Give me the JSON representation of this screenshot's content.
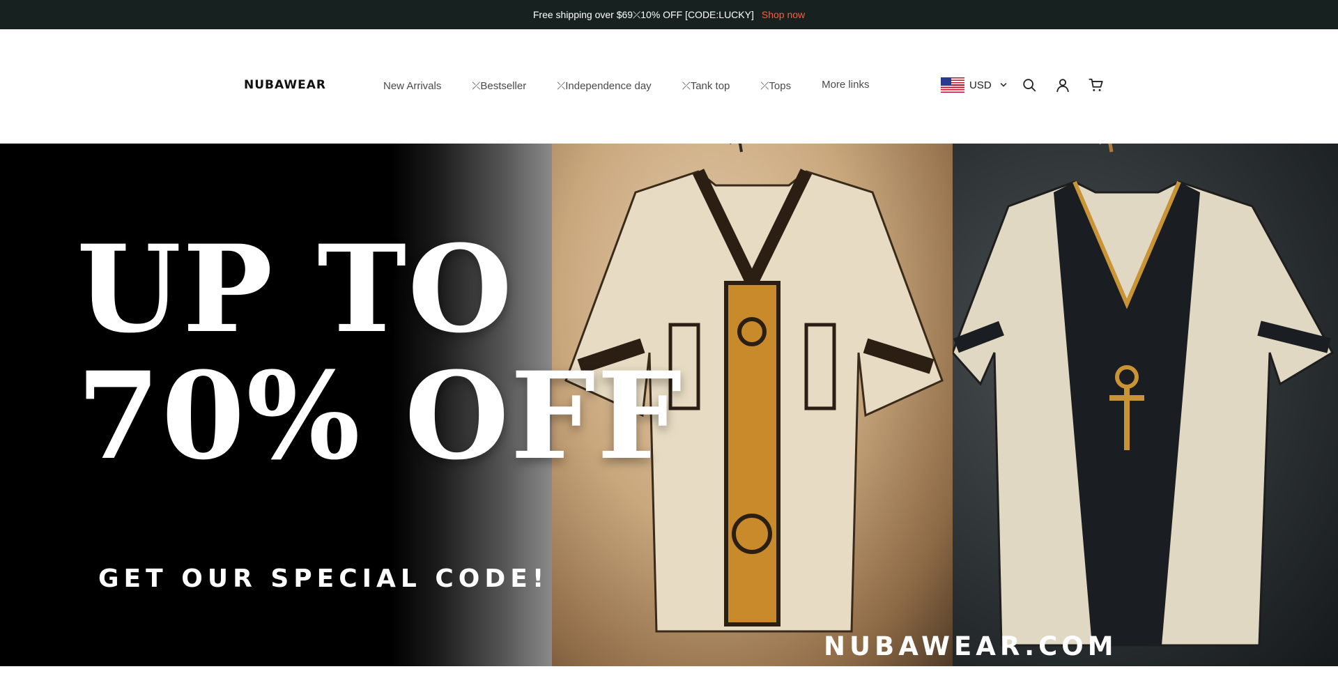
{
  "announcement": {
    "text": "Free shipping over $69⤫10% OFF [CODE:LUCKY]",
    "link_label": "Shop now",
    "link_color": "#ff5a3c",
    "background": "#172220"
  },
  "header": {
    "logo": "NUBAWEAR",
    "nav": [
      {
        "label": "New Arrivals"
      },
      {
        "label": "⤫Bestseller"
      },
      {
        "label": "⤫Independence day"
      },
      {
        "label": "⤫Tank top"
      },
      {
        "label": "⤫Tops"
      },
      {
        "label": "More links"
      }
    ],
    "currency": {
      "code": "USD",
      "flag": "us-flag-icon"
    },
    "icons": [
      "search-icon",
      "account-icon",
      "cart-icon"
    ]
  },
  "hero": {
    "headline_line1": "UP TO",
    "headline_line2": "70% OFF",
    "subheadline": "GET OUR SPECIAL CODE!",
    "watermark": "NUBAWEAR.COM",
    "images": [
      "embroidered-tunic-beige-photo",
      "ankh-embroidered-shirt-photo"
    ]
  }
}
